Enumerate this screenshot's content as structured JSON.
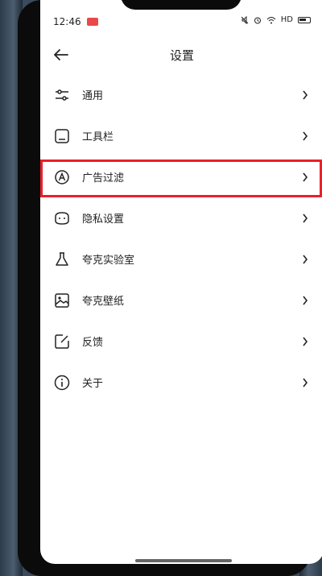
{
  "status_bar": {
    "time": "12:46",
    "network": "HD",
    "icons": [
      "mute-icon",
      "alarm-icon",
      "wifi-icon",
      "battery-icon"
    ]
  },
  "header": {
    "title": "设置",
    "back_icon": "arrow-left-icon"
  },
  "settings": {
    "items": [
      {
        "label": "通用",
        "icon": "sliders-icon"
      },
      {
        "label": "工具栏",
        "icon": "toolbar-icon"
      },
      {
        "label": "广告过滤",
        "icon": "ad-filter-icon",
        "highlighted": true
      },
      {
        "label": "隐私设置",
        "icon": "privacy-mask-icon"
      },
      {
        "label": "夸克实验室",
        "icon": "flask-icon"
      },
      {
        "label": "夸克壁纸",
        "icon": "image-icon"
      },
      {
        "label": "反馈",
        "icon": "edit-icon"
      },
      {
        "label": "关于",
        "icon": "info-icon"
      }
    ]
  },
  "colors": {
    "highlight": "#e8202a",
    "text": "#222222",
    "background": "#ffffff"
  }
}
